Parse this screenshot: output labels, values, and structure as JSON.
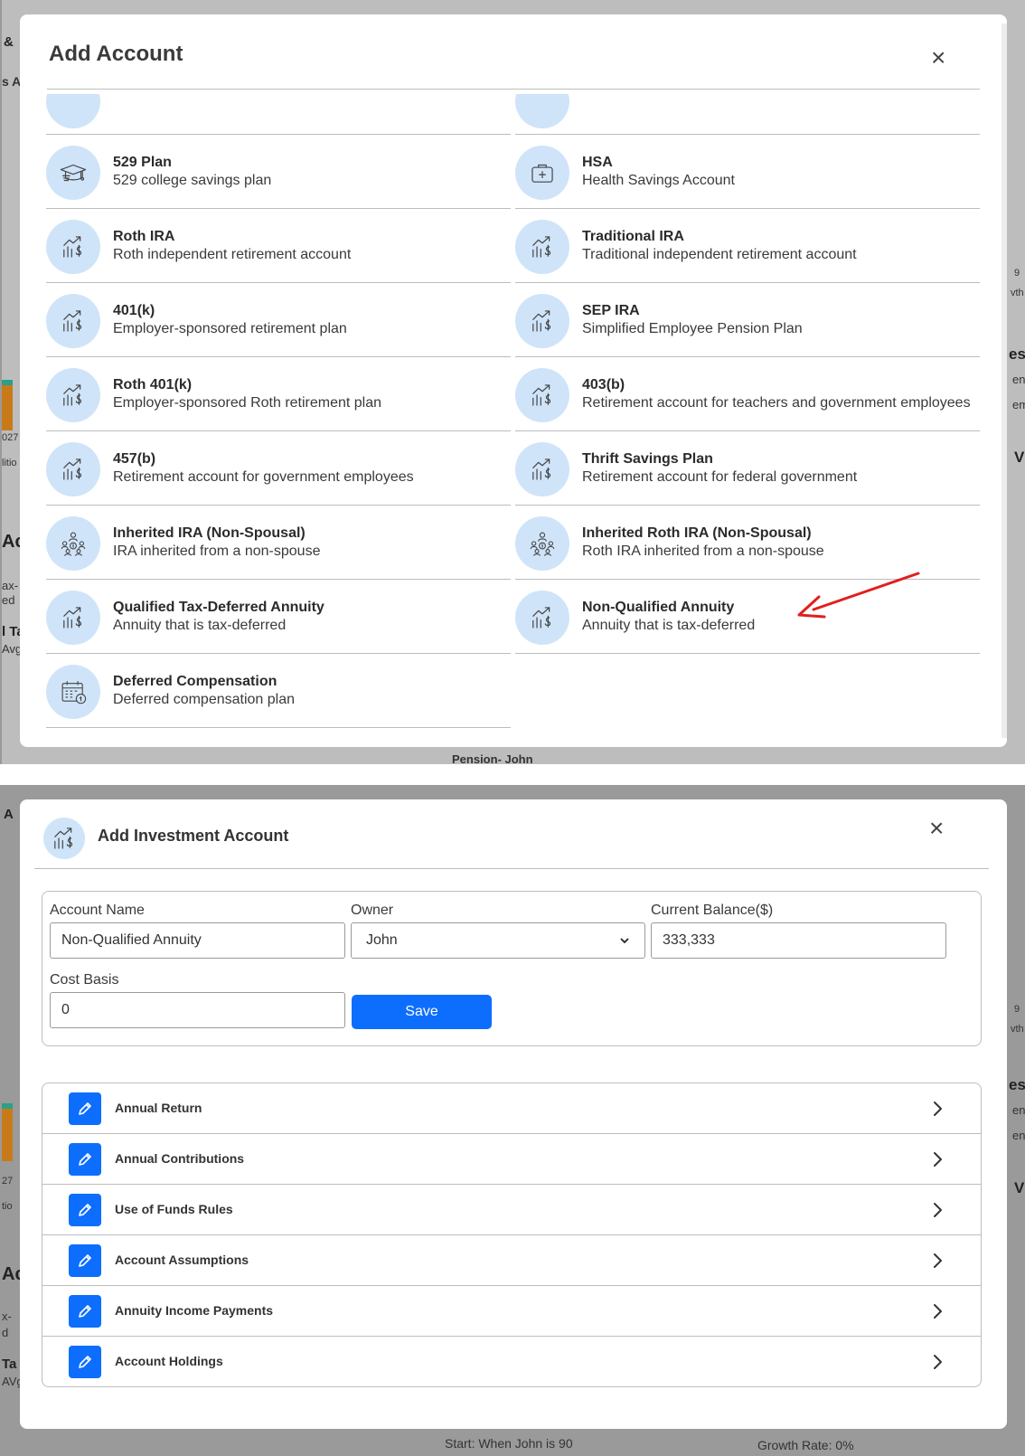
{
  "add_account": {
    "title": "Add Account",
    "close_glyph": "×",
    "left_column": [
      {
        "name": "529 Plan",
        "desc": "529 college savings plan",
        "icon": "graduation-cap-icon"
      },
      {
        "name": "Roth IRA",
        "desc": "Roth independent retirement account",
        "icon": "chart-dollar-icon"
      },
      {
        "name": "401(k)",
        "desc": "Employer-sponsored retirement plan",
        "icon": "chart-dollar-icon"
      },
      {
        "name": "Roth 401(k)",
        "desc": "Employer-sponsored Roth retirement plan",
        "icon": "chart-dollar-icon"
      },
      {
        "name": "457(b)",
        "desc": "Retirement account for government employees",
        "icon": "chart-dollar-icon"
      },
      {
        "name": "Inherited IRA (Non-Spousal)",
        "desc": "IRA inherited from a non-spouse",
        "icon": "people-dollar-icon"
      },
      {
        "name": "Qualified Tax-Deferred Annuity",
        "desc": "Annuity that is tax-deferred",
        "icon": "chart-dollar-icon"
      },
      {
        "name": "Deferred Compensation",
        "desc": "Deferred compensation plan",
        "icon": "calendar-dollar-icon"
      }
    ],
    "right_column": [
      {
        "name": "HSA",
        "desc": "Health Savings Account",
        "icon": "medical-kit-icon"
      },
      {
        "name": "Traditional IRA",
        "desc": "Traditional independent retirement account",
        "icon": "chart-dollar-icon"
      },
      {
        "name": "SEP IRA",
        "desc": "Simplified Employee Pension Plan",
        "icon": "chart-dollar-icon"
      },
      {
        "name": "403(b)",
        "desc": "Retirement account for teachers and government employees",
        "icon": "chart-dollar-icon"
      },
      {
        "name": "Thrift Savings Plan",
        "desc": "Retirement account for federal government",
        "icon": "chart-dollar-icon"
      },
      {
        "name": "Inherited Roth IRA (Non-Spousal)",
        "desc": "Roth IRA inherited from a non-spouse",
        "icon": "people-dollar-icon"
      },
      {
        "name": "Non-Qualified Annuity",
        "desc": "Annuity that is tax-deferred",
        "icon": "chart-dollar-icon"
      }
    ],
    "annotation_color": "#e0201c"
  },
  "background_fragments": {
    "top": [
      "&",
      "s A",
      "027",
      "litio",
      "Ac",
      "ax-",
      "ed",
      "l Ta",
      "Avg",
      "Pension- John",
      "9",
      "vth",
      "es",
      "en",
      "em",
      "V"
    ],
    "bottom": [
      "A",
      "27",
      "tio",
      "Ac",
      "x-",
      "d",
      "Ta",
      "AVg",
      "9",
      "vth",
      "es",
      "en",
      "en",
      "V",
      "Start: When John is 90",
      "Growth Rate: 0%"
    ]
  },
  "add_investment": {
    "title": "Add Investment Account",
    "header_icon": "chart-dollar-icon",
    "close_glyph": "×",
    "fields": {
      "account_name_label": "Account Name",
      "account_name_value": "Non-Qualified Annuity",
      "owner_label": "Owner",
      "owner_value": "John",
      "balance_label": "Current Balance($)",
      "balance_value": "333,333",
      "cost_basis_label": "Cost Basis",
      "cost_basis_value": "0"
    },
    "save_label": "Save",
    "sections": [
      {
        "label": "Annual Return"
      },
      {
        "label": "Annual Contributions"
      },
      {
        "label": "Use of Funds Rules"
      },
      {
        "label": "Account Assumptions"
      },
      {
        "label": "Annuity Income Payments"
      },
      {
        "label": "Account Holdings"
      }
    ],
    "accent_color": "#0d6efd"
  }
}
